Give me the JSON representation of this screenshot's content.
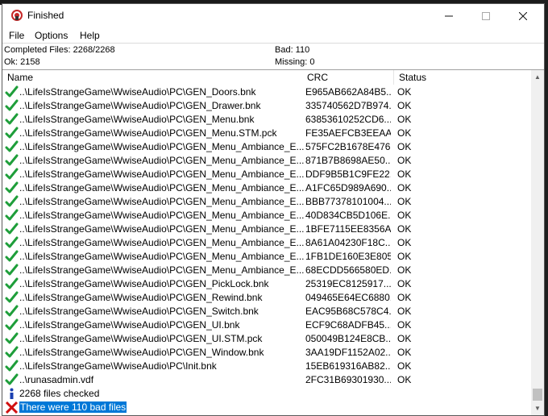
{
  "window": {
    "title": "Finished"
  },
  "menu": [
    "File",
    "Options",
    "Help"
  ],
  "stats": {
    "completed": "Completed Files: 2268/2268",
    "ok": "Ok: 2158",
    "bad": "Bad: 110",
    "missing": "Missing: 0"
  },
  "columns": {
    "name": "Name",
    "crc": "CRC",
    "status": "Status"
  },
  "rows": [
    {
      "icon": "check",
      "name": "..\\LifeIsStrangeGame\\WwiseAudio\\PC\\GEN_Doors.bnk",
      "crc": "E965AB662A84B5...",
      "status": "OK"
    },
    {
      "icon": "check",
      "name": "..\\LifeIsStrangeGame\\WwiseAudio\\PC\\GEN_Drawer.bnk",
      "crc": "335740562D7B974...",
      "status": "OK"
    },
    {
      "icon": "check",
      "name": "..\\LifeIsStrangeGame\\WwiseAudio\\PC\\GEN_Menu.bnk",
      "crc": "63853610252CD6...",
      "status": "OK"
    },
    {
      "icon": "check",
      "name": "..\\LifeIsStrangeGame\\WwiseAudio\\PC\\GEN_Menu.STM.pck",
      "crc": "FE35AEFCB3EEAA...",
      "status": "OK"
    },
    {
      "icon": "check",
      "name": "..\\LifeIsStrangeGame\\WwiseAudio\\PC\\GEN_Menu_Ambiance_E...",
      "crc": "575FC2B1678E476...",
      "status": "OK"
    },
    {
      "icon": "check",
      "name": "..\\LifeIsStrangeGame\\WwiseAudio\\PC\\GEN_Menu_Ambiance_E...",
      "crc": "871B7B8698AE50...",
      "status": "OK"
    },
    {
      "icon": "check",
      "name": "..\\LifeIsStrangeGame\\WwiseAudio\\PC\\GEN_Menu_Ambiance_E...",
      "crc": "DDF9B5B1C9FE22...",
      "status": "OK"
    },
    {
      "icon": "check",
      "name": "..\\LifeIsStrangeGame\\WwiseAudio\\PC\\GEN_Menu_Ambiance_E...",
      "crc": "A1FC65D989A690...",
      "status": "OK"
    },
    {
      "icon": "check",
      "name": "..\\LifeIsStrangeGame\\WwiseAudio\\PC\\GEN_Menu_Ambiance_E...",
      "crc": "BBB77378101004...",
      "status": "OK"
    },
    {
      "icon": "check",
      "name": "..\\LifeIsStrangeGame\\WwiseAudio\\PC\\GEN_Menu_Ambiance_E...",
      "crc": "40D834CB5D106E...",
      "status": "OK"
    },
    {
      "icon": "check",
      "name": "..\\LifeIsStrangeGame\\WwiseAudio\\PC\\GEN_Menu_Ambiance_E...",
      "crc": "1BFE7115EE8356A...",
      "status": "OK"
    },
    {
      "icon": "check",
      "name": "..\\LifeIsStrangeGame\\WwiseAudio\\PC\\GEN_Menu_Ambiance_E...",
      "crc": "8A61A04230F18C...",
      "status": "OK"
    },
    {
      "icon": "check",
      "name": "..\\LifeIsStrangeGame\\WwiseAudio\\PC\\GEN_Menu_Ambiance_E...",
      "crc": "1FB1DE160E3E805...",
      "status": "OK"
    },
    {
      "icon": "check",
      "name": "..\\LifeIsStrangeGame\\WwiseAudio\\PC\\GEN_Menu_Ambiance_E...",
      "crc": "68ECDD566580ED...",
      "status": "OK"
    },
    {
      "icon": "check",
      "name": "..\\LifeIsStrangeGame\\WwiseAudio\\PC\\GEN_PickLock.bnk",
      "crc": "25319EC8125917...",
      "status": "OK"
    },
    {
      "icon": "check",
      "name": "..\\LifeIsStrangeGame\\WwiseAudio\\PC\\GEN_Rewind.bnk",
      "crc": "049465E64EC6880...",
      "status": "OK"
    },
    {
      "icon": "check",
      "name": "..\\LifeIsStrangeGame\\WwiseAudio\\PC\\GEN_Switch.bnk",
      "crc": "EAC95B68C578C4...",
      "status": "OK"
    },
    {
      "icon": "check",
      "name": "..\\LifeIsStrangeGame\\WwiseAudio\\PC\\GEN_UI.bnk",
      "crc": "ECF9C68ADFB45...",
      "status": "OK"
    },
    {
      "icon": "check",
      "name": "..\\LifeIsStrangeGame\\WwiseAudio\\PC\\GEN_UI.STM.pck",
      "crc": "050049B124E8CB...",
      "status": "OK"
    },
    {
      "icon": "check",
      "name": "..\\LifeIsStrangeGame\\WwiseAudio\\PC\\GEN_Window.bnk",
      "crc": "3AA19DF1152A02...",
      "status": "OK"
    },
    {
      "icon": "check",
      "name": "..\\LifeIsStrangeGame\\WwiseAudio\\PC\\Init.bnk",
      "crc": "15EB619316AB82...",
      "status": "OK"
    },
    {
      "icon": "check",
      "name": "..\\runasadmin.vdf",
      "crc": "2FC31B69301930...",
      "status": "OK"
    },
    {
      "icon": "info",
      "name": "2268 files checked",
      "crc": "",
      "status": ""
    },
    {
      "icon": "cross",
      "name": "There were 110 bad files",
      "crc": "",
      "status": "",
      "selected": true
    }
  ],
  "colors": {
    "check": "#1e9e3a",
    "info": "#1a3fb0",
    "cross": "#d01010",
    "selection": "#0078d7"
  }
}
